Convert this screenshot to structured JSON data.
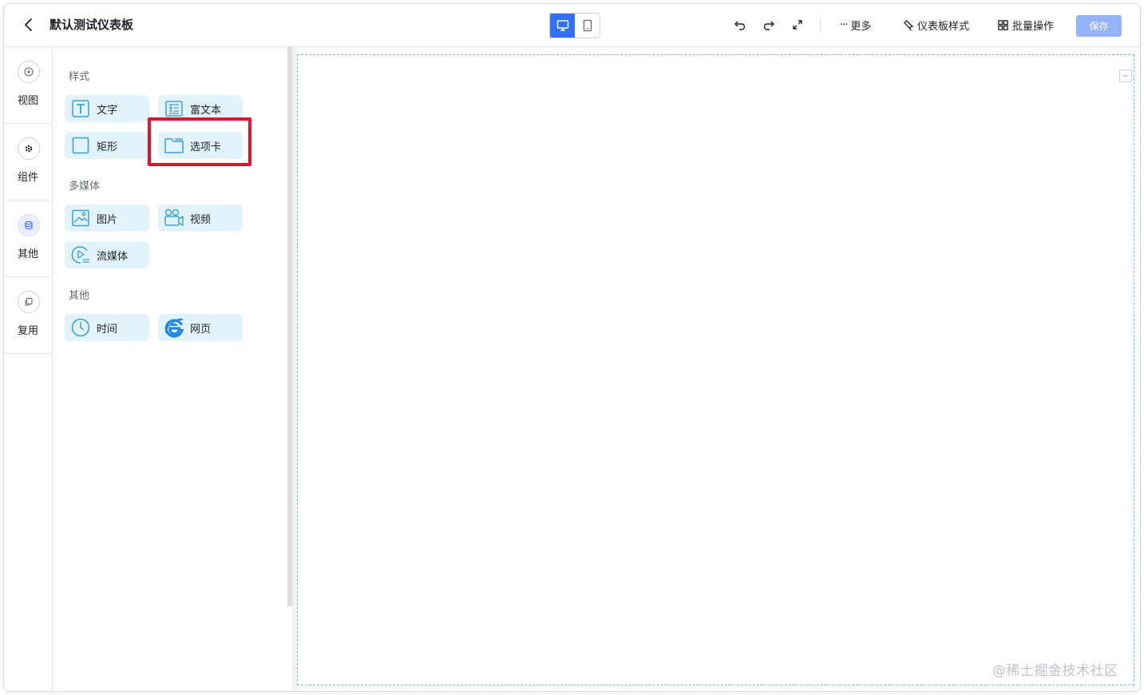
{
  "header": {
    "title": "默认测试仪表板",
    "more_label": "更多",
    "style_label": "仪表板样式",
    "batch_label": "批量操作",
    "save_label": "保存"
  },
  "rail": {
    "items": [
      {
        "label": "视图",
        "icon": "plus-circle-icon"
      },
      {
        "label": "组件",
        "icon": "gear-icon"
      },
      {
        "label": "其他",
        "icon": "database-icon"
      },
      {
        "label": "复用",
        "icon": "copy-icon"
      }
    ]
  },
  "panel": {
    "sections": [
      {
        "title": "样式",
        "items": [
          "文字",
          "富文本",
          "矩形",
          "选项卡"
        ]
      },
      {
        "title": "多媒体",
        "items": [
          "图片",
          "视频",
          "流媒体"
        ]
      },
      {
        "title": "其他",
        "items": [
          "时间",
          "网页"
        ]
      }
    ]
  },
  "watermark": "@稀土掘金技术社区",
  "colors": {
    "accent": "#3370ff",
    "save_disabled": "#94b3fb",
    "component_bg": "#e3f3fb",
    "component_icon": "#3a9fd8",
    "highlight": "#e8112d"
  }
}
